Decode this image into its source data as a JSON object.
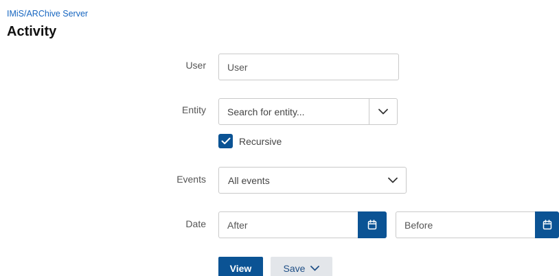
{
  "breadcrumb": "IMiS/ARChive Server",
  "page_title": "Activity",
  "form": {
    "user": {
      "label": "User",
      "placeholder": "User",
      "value": ""
    },
    "entity": {
      "label": "Entity",
      "placeholder": "Search for entity...",
      "dropdown_icon": "chevron-down-icon"
    },
    "recursive": {
      "label": "Recursive",
      "checked": true
    },
    "events": {
      "label": "Events",
      "selected": "All events",
      "dropdown_icon": "chevron-down-icon"
    },
    "date": {
      "label": "Date",
      "after_placeholder": "After",
      "before_placeholder": "Before",
      "calendar_icon": "calendar-icon"
    }
  },
  "actions": {
    "view_label": "View",
    "save_label": "Save"
  },
  "colors": {
    "accent": "#0b5394",
    "link": "#1565c0",
    "secondary_button_bg": "#e3e6ea"
  }
}
